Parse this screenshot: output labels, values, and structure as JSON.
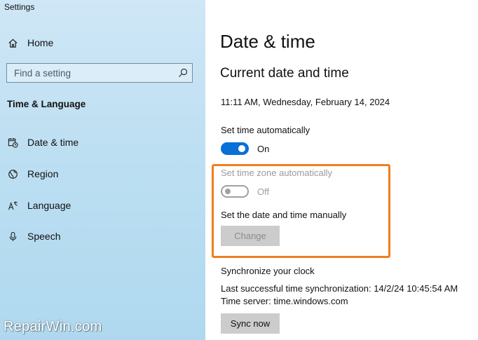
{
  "window": {
    "title": "Settings"
  },
  "sidebar": {
    "home_label": "Home",
    "search_placeholder": "Find a setting",
    "section_heading": "Time & Language",
    "items": [
      {
        "label": "Date & time",
        "icon": "calendar-clock-icon"
      },
      {
        "label": "Region",
        "icon": "globe-icon"
      },
      {
        "label": "Language",
        "icon": "language-icon"
      },
      {
        "label": "Speech",
        "icon": "microphone-icon"
      }
    ]
  },
  "main": {
    "page_title": "Date & time",
    "section_title": "Current date and time",
    "current_datetime": "11:11 AM, Wednesday, February 14, 2024",
    "set_time_auto": {
      "label": "Set time automatically",
      "state_label": "On",
      "enabled": true
    },
    "set_timezone_auto": {
      "label": "Set time zone automatically",
      "state_label": "Off",
      "enabled": false,
      "disabled": true
    },
    "manual": {
      "label": "Set the date and time manually",
      "button_label": "Change",
      "disabled": true
    },
    "sync": {
      "heading": "Synchronize your clock",
      "last_sync": "Last successful time synchronization: 14/2/24 10:45:54 AM",
      "server": "Time server: time.windows.com",
      "button_label": "Sync now"
    }
  },
  "watermark": {
    "text": "RepairWin.com"
  },
  "colors": {
    "accent": "#0a6fd6",
    "highlight": "#f07f1e",
    "sidebar_bg": "#bddff2"
  }
}
